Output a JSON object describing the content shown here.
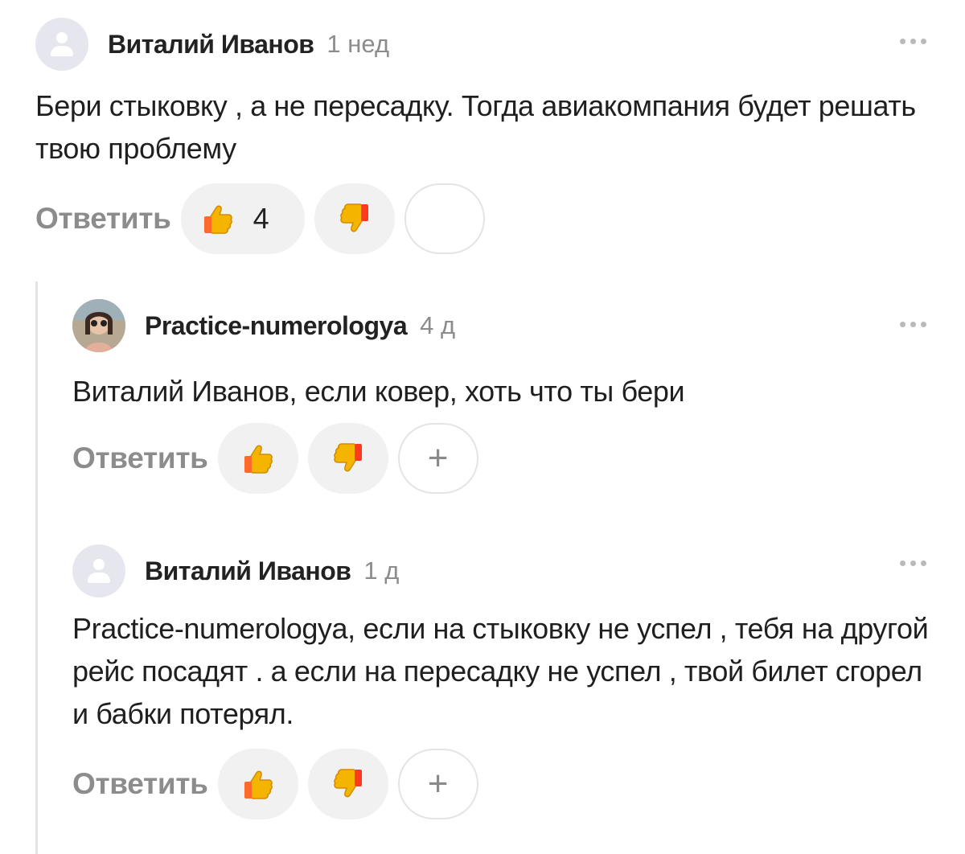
{
  "comments": [
    {
      "author": "Виталий Иванов",
      "time": "1 нед",
      "text": "Бери стыковку , а не пересадку. Тогда авиакомпания будет решать твою проблему",
      "reply_label": "Ответить",
      "like_count": "4",
      "avatar": "default-user-icon"
    },
    {
      "author": "Practice-numerologya",
      "time": "4 д",
      "text": "Виталий Иванов, если ковер, хоть что ты бери",
      "reply_label": "Ответить",
      "add_reaction": "+",
      "avatar": "user-photo"
    },
    {
      "author": "Виталий Иванов",
      "time": "1 д",
      "text": "Practice-numerologya, если на стыковку не успел , тебя на другой рейс посадят . а если на пересадку не успел , твой билет сгорел и бабки потерял.",
      "reply_label": "Ответить",
      "add_reaction": "+",
      "avatar": "default-user-icon"
    }
  ],
  "colors": {
    "author": "#222222",
    "muted": "#8c8c8c",
    "pill_bg": "#f1f1f1",
    "thumb": "#f5b400"
  },
  "icons": {
    "like": "thumbs-up-icon",
    "dislike": "thumbs-down-icon",
    "more": "more-dots-icon"
  }
}
